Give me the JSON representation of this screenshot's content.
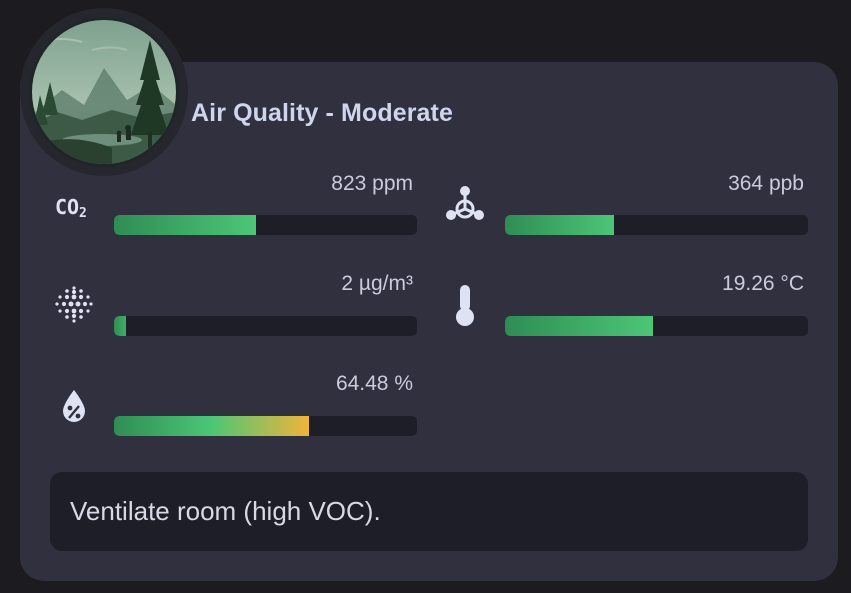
{
  "card": {
    "title": "Air Quality - Moderate"
  },
  "metrics": [
    {
      "id": "co2",
      "icon": "co2-icon",
      "icon_text": "CO₂",
      "value": "823 ppm",
      "fill": 0.47,
      "gradient": [
        "#2f8d54",
        "#4cc677"
      ]
    },
    {
      "id": "voc",
      "icon": "molecule-icon",
      "value": "364 ppb",
      "fill": 0.36,
      "gradient": [
        "#2f8d54",
        "#4cc677"
      ]
    },
    {
      "id": "pm25",
      "icon": "particles-icon",
      "value": "2 µg/m³",
      "fill": 0.04,
      "gradient": [
        "#2f8d54",
        "#3fae66"
      ]
    },
    {
      "id": "temperature",
      "icon": "thermometer-icon",
      "value": "19.26 °C",
      "fill": 0.49,
      "gradient": [
        "#2f8d54",
        "#4cc677"
      ]
    },
    {
      "id": "humidity",
      "icon": "water-percent-icon",
      "value": "64.48 %",
      "fill": 0.645,
      "gradient": [
        "#2f8d54",
        "#4cc677",
        "#f0b43a"
      ]
    }
  ],
  "message": {
    "text": "Ventilate room (high VOC)."
  },
  "colors": {
    "background": "#1c1c20",
    "card": "#30303f",
    "bar_track": "#1e1e28",
    "title": "#d0d5ee"
  }
}
